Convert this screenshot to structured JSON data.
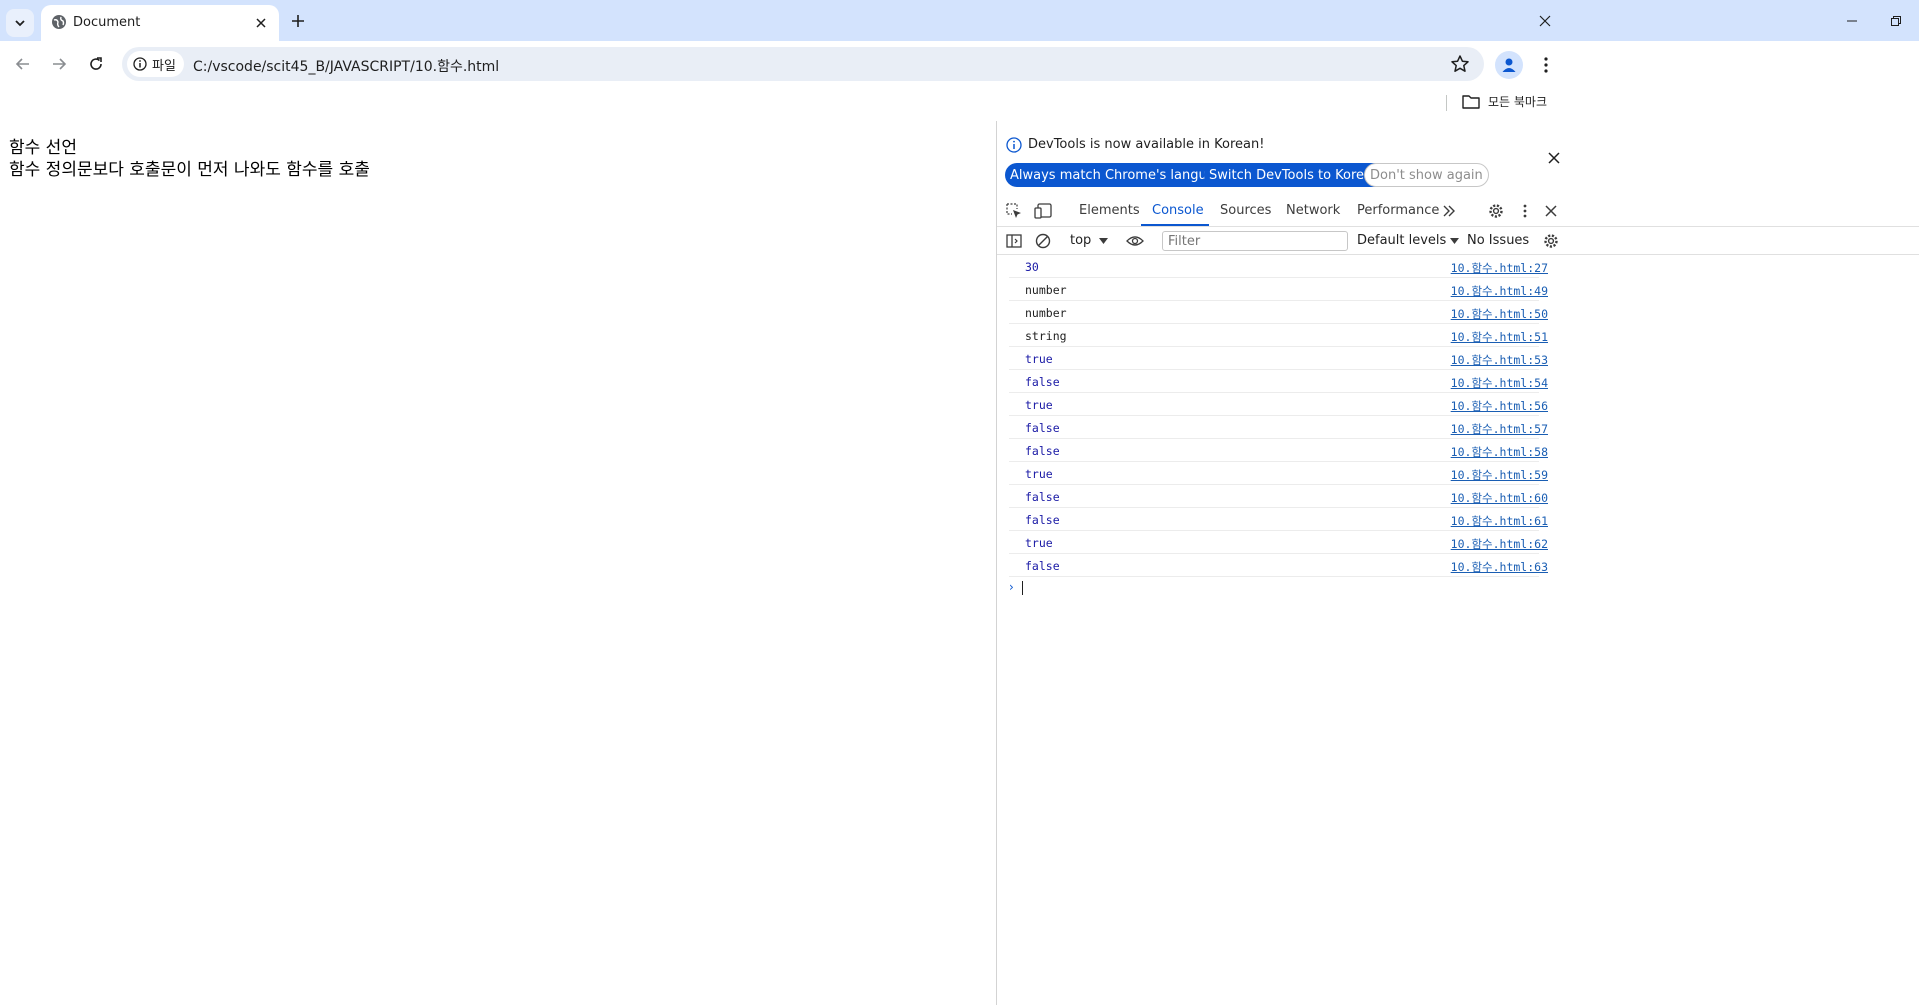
{
  "browser": {
    "tab_title": "Document",
    "url_chip_label": "파일",
    "url": "C:/vscode/scit45_B/JAVASCRIPT/10.함수.html",
    "bookmarks_all_label": "모든 북마크"
  },
  "page": {
    "line1": "함수 선언",
    "line2": "함수 정의문보다 호출문이 먼저 나와도 함수를 호출"
  },
  "devtools": {
    "infobar_text": "DevTools is now available in Korean!",
    "btn_match": "Always match Chrome's language",
    "btn_switch": "Switch DevTools to Korean",
    "btn_dont_show": "Don't show again",
    "tabs": {
      "elements": "Elements",
      "console": "Console",
      "sources": "Sources",
      "network": "Network",
      "performance": "Performance"
    },
    "active_tab": "Console",
    "context": "top",
    "filter_placeholder": "Filter",
    "levels": "Default levels",
    "issues": "No Issues",
    "console": [
      {
        "value": "30",
        "kind": "number",
        "source": "10.함수.html:27"
      },
      {
        "value": "number",
        "kind": "string",
        "source": "10.함수.html:49"
      },
      {
        "value": "number",
        "kind": "string",
        "source": "10.함수.html:50"
      },
      {
        "value": "string",
        "kind": "string",
        "source": "10.함수.html:51"
      },
      {
        "value": "true",
        "kind": "boolean",
        "source": "10.함수.html:53"
      },
      {
        "value": "false",
        "kind": "boolean",
        "source": "10.함수.html:54"
      },
      {
        "value": "true",
        "kind": "boolean",
        "source": "10.함수.html:56"
      },
      {
        "value": "false",
        "kind": "boolean",
        "source": "10.함수.html:57"
      },
      {
        "value": "false",
        "kind": "boolean",
        "source": "10.함수.html:58"
      },
      {
        "value": "true",
        "kind": "boolean",
        "source": "10.함수.html:59"
      },
      {
        "value": "false",
        "kind": "boolean",
        "source": "10.함수.html:60"
      },
      {
        "value": "false",
        "kind": "boolean",
        "source": "10.함수.html:61"
      },
      {
        "value": "true",
        "kind": "boolean",
        "source": "10.함수.html:62"
      },
      {
        "value": "false",
        "kind": "boolean",
        "source": "10.함수.html:63"
      }
    ]
  },
  "colors": {
    "tabstrip": "#d3e3fd",
    "accent": "#0b57d0",
    "link": "#1a5eb3",
    "console_value": "#1a1aa6"
  }
}
